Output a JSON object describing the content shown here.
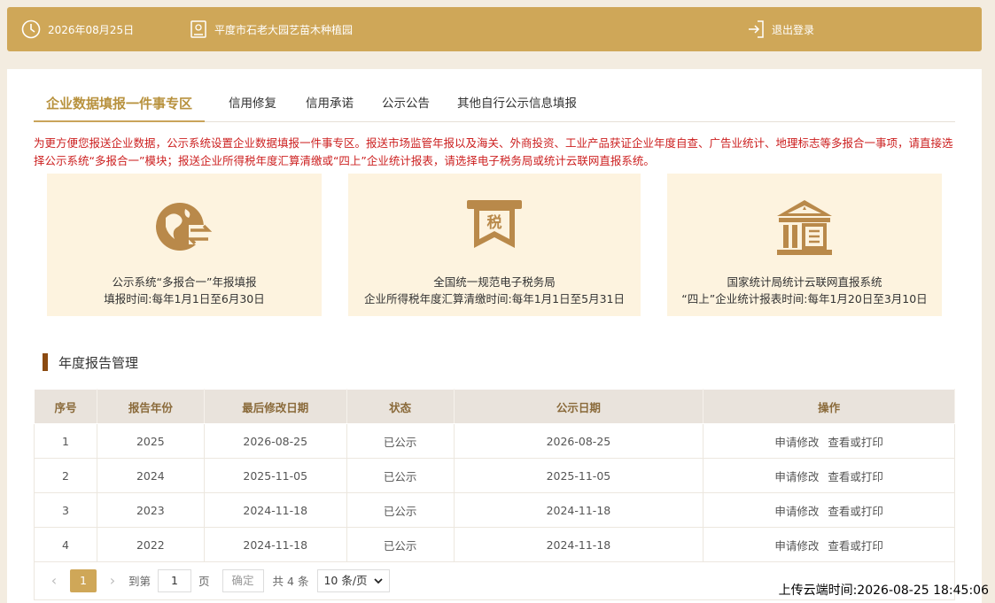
{
  "topbar": {
    "date": "2026年08月25日",
    "company": "平度市石老大园艺苗木种植园",
    "logout": "退出登录",
    "color": "#cfa758"
  },
  "tabs": [
    {
      "label": "企业数据填报一件事专区",
      "active": true
    },
    {
      "label": "信用修复"
    },
    {
      "label": "信用承诺"
    },
    {
      "label": "公示公告"
    },
    {
      "label": "其他自行公示信息填报"
    }
  ],
  "notice": "为更方便您报送企业数据，公示系统设置企业数据填报一件事专区。报送市场监管年报以及海关、外商投资、工业产品获证企业年度自查、广告业统计、地理标志等多报合一事项，请直接选择公示系统“多报合一”模块；报送企业所得税年度汇算清缴或“四上”企业统计报表，请选择电子税务局或统计云联网直报系统。",
  "cards": [
    {
      "icon": "globe-exchange-icon",
      "line1": "公示系统“多报合一”年报填报",
      "line2": "填报时间:每年1月1日至6月30日"
    },
    {
      "icon": "tax-icon",
      "icon_text": "税",
      "line1": "全国统一规范电子税务局",
      "line2": "企业所得税年度汇算清缴时间:每年1月1日至5月31日"
    },
    {
      "icon": "government-building-icon",
      "line1": "国家统计局统计云联网直报系统",
      "line2": "“四上”企业统计报表时间:每年1月20日至3月10日"
    }
  ],
  "section_title": "年度报告管理",
  "table": {
    "headers": [
      "序号",
      "报告年份",
      "最后修改日期",
      "状态",
      "公示日期",
      "操作"
    ],
    "rows": [
      {
        "no": "1",
        "year": "2025",
        "modified": "2026-08-25",
        "status": "已公示",
        "published": "2026-08-25"
      },
      {
        "no": "2",
        "year": "2024",
        "modified": "2025-11-05",
        "status": "已公示",
        "published": "2025-11-05"
      },
      {
        "no": "3",
        "year": "2023",
        "modified": "2024-11-18",
        "status": "已公示",
        "published": "2024-11-18"
      },
      {
        "no": "4",
        "year": "2022",
        "modified": "2024-11-18",
        "status": "已公示",
        "published": "2024-11-18"
      }
    ],
    "op_modify": "申请修改",
    "op_view": "查看或打印"
  },
  "pager": {
    "current_page": "1",
    "goto_prefix": "到第",
    "goto_value": "1",
    "goto_suffix": "页",
    "confirm": "确定",
    "total": "共 4 条",
    "page_size": "10 条/页"
  },
  "upload_time": "上传云端时间:2026-08-25 18:45:06"
}
